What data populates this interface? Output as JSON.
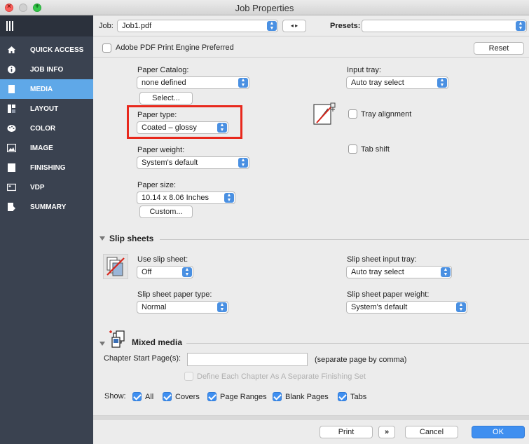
{
  "window": {
    "title": "Job Properties"
  },
  "sidebar": {
    "items": [
      {
        "label": "QUICK ACCESS",
        "icon": "home-icon"
      },
      {
        "label": "JOB INFO",
        "icon": "info-icon"
      },
      {
        "label": "MEDIA",
        "icon": "document-icon",
        "active": true
      },
      {
        "label": "LAYOUT",
        "icon": "layout-icon"
      },
      {
        "label": "COLOR",
        "icon": "palette-icon"
      },
      {
        "label": "IMAGE",
        "icon": "image-icon"
      },
      {
        "label": "FINISHING",
        "icon": "finishing-icon"
      },
      {
        "label": "VDP",
        "icon": "vdp-icon"
      },
      {
        "label": "SUMMARY",
        "icon": "summary-icon"
      }
    ]
  },
  "jobbar": {
    "job_label": "Job:",
    "job_value": "Job1.pdf",
    "presets_label": "Presets:",
    "presets_value": ""
  },
  "pdfbar": {
    "engine_label": "Adobe PDF Print Engine Preferred",
    "reset_label": "Reset"
  },
  "media": {
    "paper_catalog_label": "Paper Catalog:",
    "paper_catalog_value": "none defined",
    "select_button": "Select...",
    "paper_type_label": "Paper type:",
    "paper_type_value": "Coated – glossy",
    "paper_weight_label": "Paper weight:",
    "paper_weight_value": "System's default",
    "paper_size_label": "Paper size:",
    "paper_size_value": "10.14 x 8.06 Inches",
    "custom_button": "Custom...",
    "input_tray_label": "Input tray:",
    "input_tray_value": "Auto tray select",
    "tray_alignment_label": "Tray alignment",
    "tab_shift_label": "Tab shift"
  },
  "slip_sheets": {
    "header": "Slip sheets",
    "use_label": "Use slip sheet:",
    "use_value": "Off",
    "input_tray_label": "Slip sheet input tray:",
    "input_tray_value": "Auto tray select",
    "paper_type_label": "Slip sheet paper type:",
    "paper_type_value": "Normal",
    "paper_weight_label": "Slip sheet paper weight:",
    "paper_weight_value": "System's default"
  },
  "mixed_media": {
    "header": "Mixed media",
    "chapter_label": "Chapter Start Page(s):",
    "chapter_value": "",
    "chapter_hint": "(separate page by comma)",
    "define_label": "Define Each Chapter As A Separate Finishing Set",
    "show_label": "Show:",
    "filters": [
      {
        "label": "All",
        "checked": true
      },
      {
        "label": "Covers",
        "checked": true
      },
      {
        "label": "Page Ranges",
        "checked": true
      },
      {
        "label": "Blank Pages",
        "checked": true
      },
      {
        "label": "Tabs",
        "checked": true
      }
    ]
  },
  "footer": {
    "print_label": "Print",
    "more_label": "»",
    "cancel_label": "Cancel",
    "ok_label": "OK"
  },
  "colors": {
    "accent": "#3f8ff0",
    "sidebar_bg": "#3a4250",
    "sidebar_active": "#5fa8e8",
    "highlight": "#e8281c"
  }
}
